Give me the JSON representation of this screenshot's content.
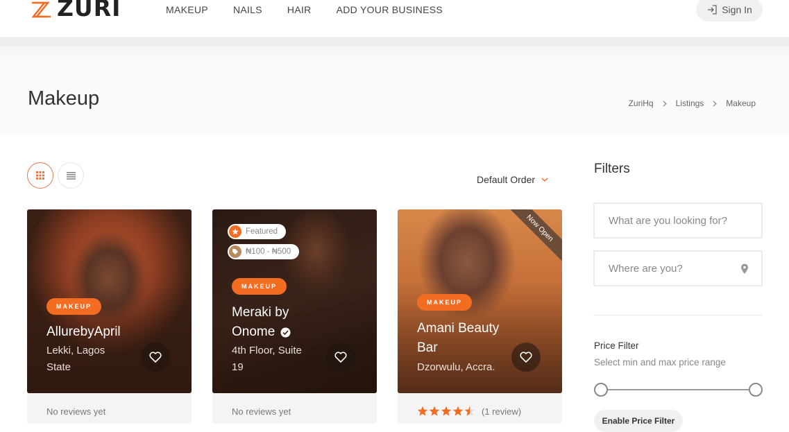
{
  "brand": {
    "name": "ZURI",
    "accent": "#f26d22"
  },
  "nav": {
    "items": [
      "MAKEUP",
      "NAILS",
      "HAIR",
      "ADD YOUR BUSINESS"
    ]
  },
  "header": {
    "signin_label": "Sign In",
    "signin_icon": "sign-in-icon"
  },
  "page": {
    "title": "Makeup"
  },
  "breadcrumb": {
    "items": [
      "ZuriHq",
      "Listings",
      "Makeup"
    ]
  },
  "toolbar": {
    "sort_label": "Default Order",
    "grid_icon": "grid-view-icon",
    "list_icon": "list-view-icon"
  },
  "listings": [
    {
      "category": "MAKEUP",
      "title_line1": "AllurebyApril",
      "location_line1": "Lekki, Lagos",
      "location_line2": "State",
      "footer": "No reviews yet"
    },
    {
      "featured_label": "Featured",
      "price_range": "₦100 - ₦500",
      "category": "MAKEUP",
      "title_line1": "Meraki by",
      "title_line2": "Onome",
      "verified_icon": "verified-check-icon",
      "location_line1": "4th Floor, Suite",
      "location_line2": "19",
      "footer": "No reviews yet"
    },
    {
      "ribbon": "Now Open",
      "category": "MAKEUP",
      "title_line1": "Amani Beauty",
      "title_line2": "Bar",
      "location_line1": "Dzorwulu, Accra.",
      "rating": 4.5,
      "review_count": "(1 review)"
    }
  ],
  "sidebar": {
    "title": "Filters",
    "search_placeholder": "What are you looking for?",
    "location_placeholder": "Where are you?",
    "price_filter_title": "Price Filter",
    "price_filter_sub": "Select min and max price range",
    "enable_button": "Enable Price Filter"
  }
}
